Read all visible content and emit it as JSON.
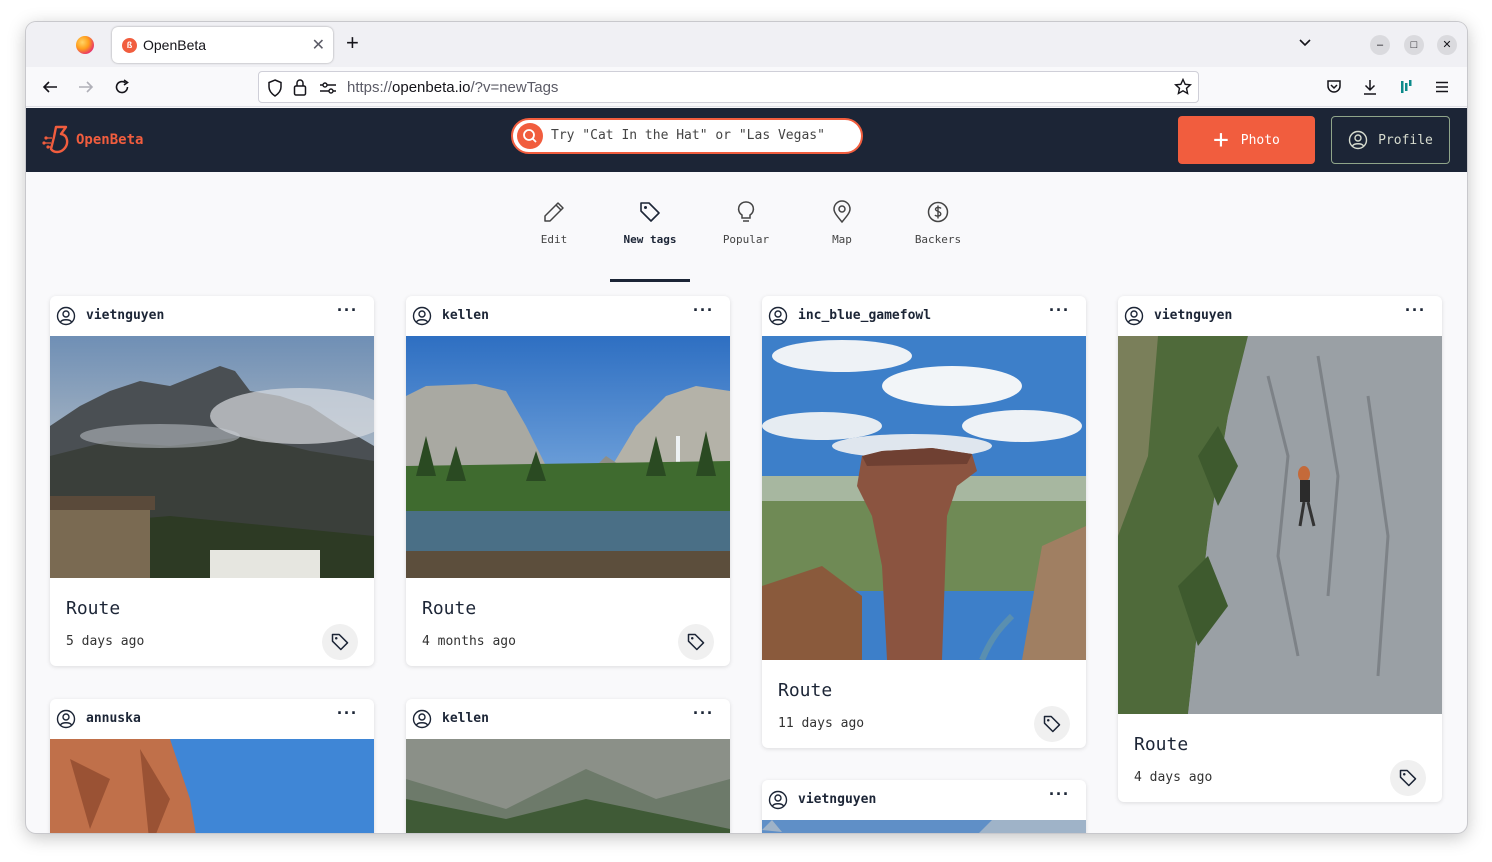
{
  "browser": {
    "tab_title": "OpenBeta",
    "tab_favicon": "openbeta-favicon",
    "url_scheme": "https://",
    "url_host": "openbeta.io",
    "url_path": "/?v=newTags"
  },
  "site": {
    "logo_text": "OpenBeta",
    "search_placeholder": "Try \"Cat In the Hat\" or \"Las Vegas\"",
    "photo_button": "Photo",
    "profile_button": "Profile"
  },
  "tabs": [
    {
      "label": "Edit",
      "icon": "pencil-icon"
    },
    {
      "label": "New tags",
      "icon": "tag-icon",
      "active": true
    },
    {
      "label": "Popular",
      "icon": "lightbulb-icon"
    },
    {
      "label": "Map",
      "icon": "map-pin-icon"
    },
    {
      "label": "Backers",
      "icon": "dollar-icon"
    }
  ],
  "cards": [
    {
      "user": "vietnguyen",
      "title": "Route",
      "date": "5 days ago",
      "scene": "cloudy mountain"
    },
    {
      "user": "kellen",
      "title": "Route",
      "date": "4 months ago",
      "scene": "valley with river"
    },
    {
      "user": "inc_blue_gamefowl",
      "title": "Route",
      "date": "11 days ago",
      "scene": "rock tower"
    },
    {
      "user": "vietnguyen",
      "title": "Route",
      "date": "4 days ago",
      "scene": "climber on rock face"
    },
    {
      "user": "annuska",
      "scene": "orange cliff"
    },
    {
      "user": "kellen",
      "scene": "forested valley"
    },
    {
      "user": "vietnguyen",
      "scene": "mountain"
    }
  ],
  "more_label": "···",
  "colors": {
    "brand": "#f15d3e",
    "header_bg": "#1c2536"
  }
}
